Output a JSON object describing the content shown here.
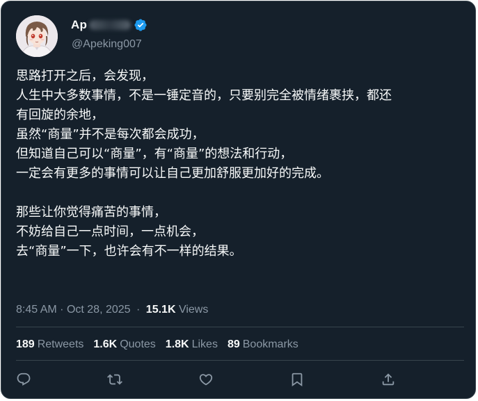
{
  "author": {
    "name": "Ap",
    "handle": "@Apeking007",
    "verified": true
  },
  "tweet": {
    "lines": [
      "思路打开之后，会发现，",
      "人生中大多数事情，不是一锤定音的，只要别完全被情绪裹挟，都还",
      "有回旋的余地，",
      "虽然“商量”并不是每次都会成功，",
      "但知道自己可以“商量”，有“商量”的想法和行动，",
      "一定会有更多的事情可以让自己更加舒服更加好的完成。",
      "",
      "那些让你觉得痛苦的事情，",
      "不妨给自己一点时间，一点机会，",
      "去“商量”一下，也许会有不一样的结果。"
    ]
  },
  "meta": {
    "time": "8:45 AM",
    "separator": "·",
    "date": "Oct 28, 2025",
    "views_count": "15.1K",
    "views_label": "Views"
  },
  "stats": {
    "retweets_count": "189",
    "retweets_label": "Retweets",
    "quotes_count": "1.6K",
    "quotes_label": "Quotes",
    "likes_count": "1.8K",
    "likes_label": "Likes",
    "bookmarks_count": "89",
    "bookmarks_label": "Bookmarks"
  },
  "actions": [
    "reply-icon",
    "retweet-icon",
    "like-icon",
    "bookmark-icon",
    "share-icon"
  ],
  "colors": {
    "background": "#15202b",
    "text": "#f7f9f9",
    "secondary": "#8b98a5",
    "border": "#38444d",
    "verified": "#1d9bf0"
  }
}
